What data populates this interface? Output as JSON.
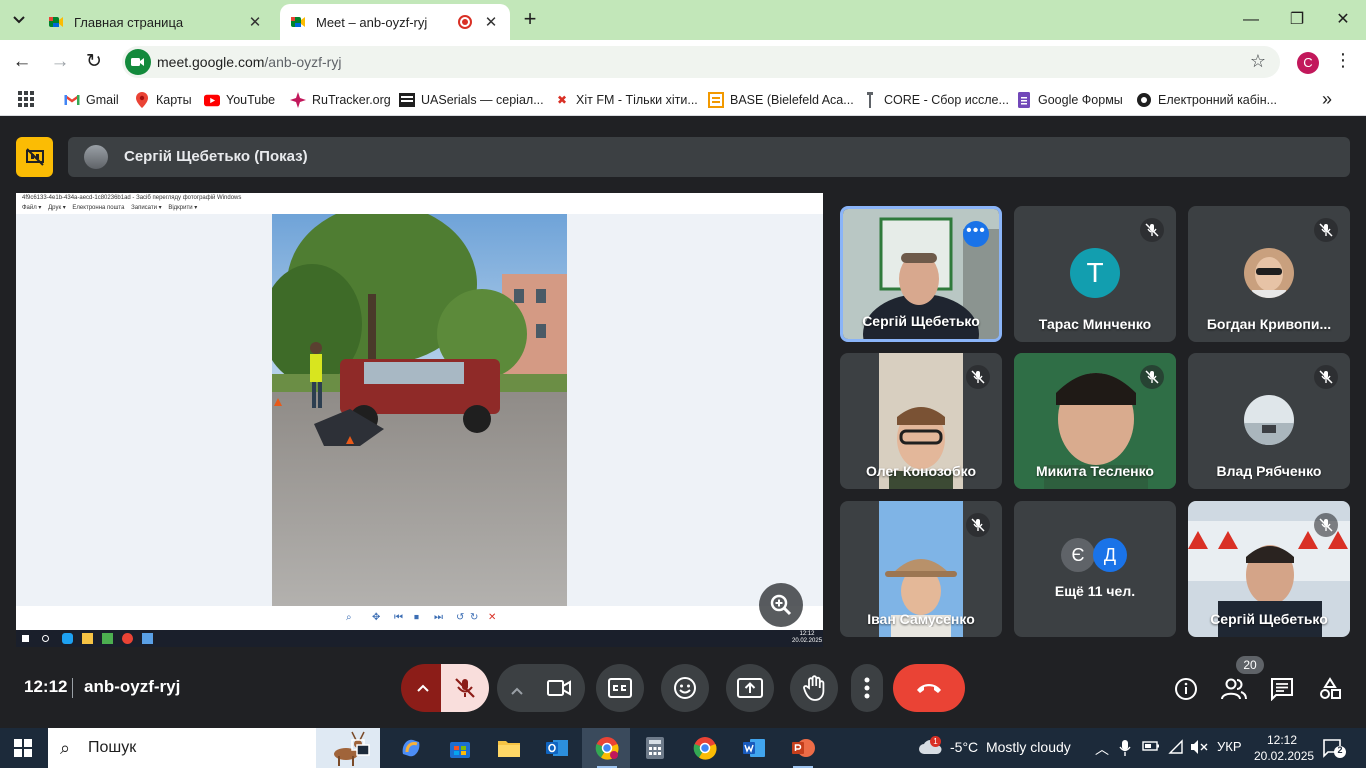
{
  "browser": {
    "tabs": [
      {
        "title": "Главная страница",
        "active": false
      },
      {
        "title": "Meet – anb-oyzf-ryj",
        "active": true
      }
    ],
    "new_tab": "+",
    "url_host": "meet.google.com",
    "url_path": "/anb-oyzf-ryj",
    "profile_initial": "C",
    "bookmarks": [
      {
        "label": "Gmail",
        "icon": "gmail-icon"
      },
      {
        "label": "Карты",
        "icon": "maps-icon"
      },
      {
        "label": "YouTube",
        "icon": "youtube-icon"
      },
      {
        "label": "RuTracker.org",
        "icon": "rutracker-icon"
      },
      {
        "label": "UASerials — серіал...",
        "icon": "uaserials-icon"
      },
      {
        "label": "Хіт FM - Тільки хіти...",
        "icon": "hitfm-icon"
      },
      {
        "label": "BASE (Bielefeld Aca...",
        "icon": "base-icon"
      },
      {
        "label": "CORE - Сбор иссле...",
        "icon": "core-icon"
      },
      {
        "label": "Google Формы",
        "icon": "forms-icon"
      },
      {
        "label": "Електронний кабін...",
        "icon": "cabinet-icon"
      }
    ]
  },
  "meet": {
    "presenter_label": "Сергій Щебетько (Показ)",
    "shared_window_title": "4f9c6133-4e1b-434a-aecd-1c80236b1ad - Засіб перегляду фотографій Windows",
    "shared_window_menu": [
      "Файл ▾",
      "Друк ▾",
      "Електронна пошта",
      "Записати ▾",
      "Відкрити ▾"
    ],
    "remote_clock": {
      "time": "12:12",
      "date": "20.02.2025"
    },
    "participants": [
      {
        "name": "Сергій Щебетько",
        "muted": false,
        "active": true
      },
      {
        "name": "Тарас Минченко",
        "muted": true,
        "avatar_letter": "T"
      },
      {
        "name": "Богдан Кривопи...",
        "muted": true
      },
      {
        "name": "Олег Конозобко",
        "muted": true
      },
      {
        "name": "Микита Тесленко",
        "muted": true
      },
      {
        "name": "Влад Рябченко",
        "muted": true
      },
      {
        "name": "Іван Самусенко",
        "muted": true
      },
      {
        "name": "Сергій Щебетько",
        "muted": true
      }
    ],
    "others": {
      "letters": [
        "Є",
        "Д"
      ],
      "label": "Ещё 11 чел."
    },
    "time": "12:12",
    "meeting_code": "anb-oyzf-ryj",
    "people_count": "20"
  },
  "taskbar": {
    "search_placeholder": "Пошук",
    "weather_temp": "-5°C",
    "weather_text": "Mostly cloudy",
    "weather_badge": "1",
    "language": "УКР",
    "time": "12:12",
    "date": "20.02.2025",
    "notifications": "2"
  },
  "colors": {
    "tabbar": "#c2e7b9",
    "meet_bg": "#202124",
    "tile_bg": "#3c4043",
    "end_call": "#ea4335",
    "mic_muted_bg": "#f9dedc",
    "present_icon": "#fbbc04"
  }
}
